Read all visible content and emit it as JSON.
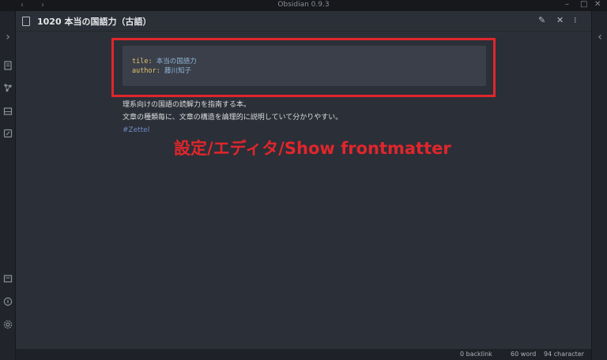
{
  "window": {
    "title": "Obsidian 0.9.3",
    "back_glyph": "‹",
    "forward_glyph": "›",
    "minimize_glyph": "–",
    "maximize_glyph": "□",
    "close_glyph": "✕"
  },
  "ribbon_left": {
    "expand_glyph": "›",
    "icons": [
      "open-file-icon",
      "graph-view-icon",
      "inbox-icon",
      "edit-icon",
      "quick-switcher-icon",
      "help-icon",
      "settings-icon"
    ]
  },
  "ribbon_right": {
    "expand_glyph": "‹"
  },
  "pane": {
    "title": "1020 本当の国語力（古語）",
    "actions": {
      "edit_glyph": "✎",
      "close_glyph": "✕",
      "more_glyph": "⁝"
    }
  },
  "frontmatter": {
    "title_key": "tile:",
    "title_value": "本当の国語力",
    "author_key": "author:",
    "author_value": "藤川知子"
  },
  "body": {
    "line1": "理系向けの国語の読解力を指南する本。",
    "line2": "文章の種類毎に、文章の構造を論理的に説明していて分かりやすい。",
    "tag": "#Zettel"
  },
  "annotation": "設定/エディタ/Show frontmatter",
  "statusbar": {
    "backlinks": "0 backlink",
    "words": "60 word",
    "characters": "94 character"
  },
  "colors": {
    "accent_red": "#e0262c",
    "tag_blue": "#6f8cc7",
    "frontmatter_key": "#e2c26b",
    "frontmatter_value": "#8fb6d6"
  }
}
